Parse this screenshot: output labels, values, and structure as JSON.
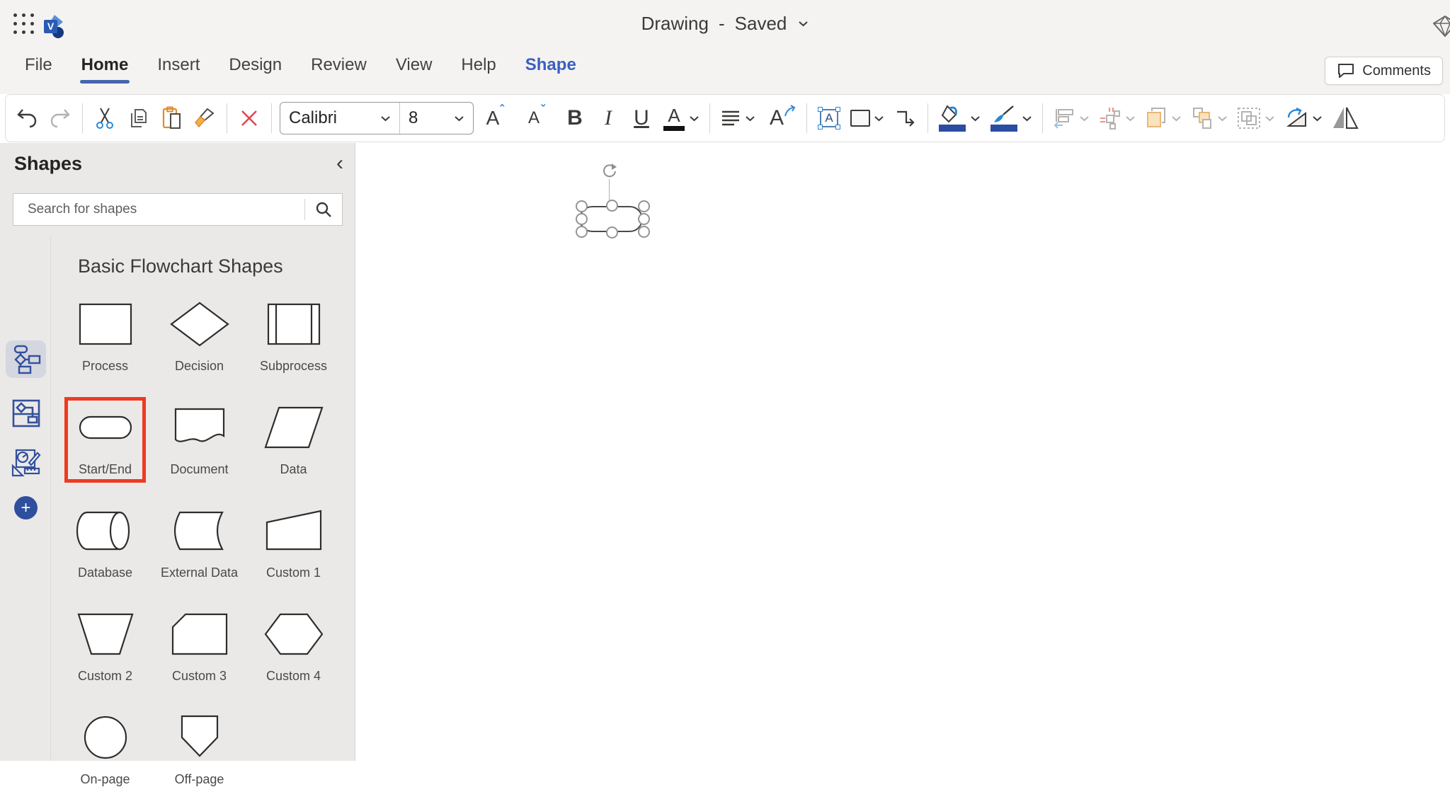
{
  "app": {
    "doc_name": "Drawing",
    "save_status": "Saved"
  },
  "menu": {
    "items": [
      {
        "label": "File",
        "state": "normal"
      },
      {
        "label": "Home",
        "state": "active"
      },
      {
        "label": "Insert",
        "state": "normal"
      },
      {
        "label": "Design",
        "state": "normal"
      },
      {
        "label": "Review",
        "state": "normal"
      },
      {
        "label": "View",
        "state": "normal"
      },
      {
        "label": "Help",
        "state": "normal"
      },
      {
        "label": "Shape",
        "state": "accent"
      }
    ],
    "comments_label": "Comments"
  },
  "toolbar": {
    "font_name": "Calibri",
    "font_size": "8",
    "bold_label": "B",
    "italic_label": "I",
    "underline_label": "U",
    "grow_font_label": "A",
    "shrink_font_label": "A",
    "font_color_label": "A",
    "text_rotate_label": "A",
    "textbox_label": "A"
  },
  "shapes_panel": {
    "title": "Shapes",
    "search_placeholder": "Search for shapes",
    "section_title": "Basic Flowchart Shapes",
    "items": [
      {
        "label": "Process",
        "icon": "process"
      },
      {
        "label": "Decision",
        "icon": "decision"
      },
      {
        "label": "Subprocess",
        "icon": "subprocess"
      },
      {
        "label": "Start/End",
        "icon": "startend",
        "highlighted": true
      },
      {
        "label": "Document",
        "icon": "document"
      },
      {
        "label": "Data",
        "icon": "data"
      },
      {
        "label": "Database",
        "icon": "database"
      },
      {
        "label": "External Data",
        "icon": "external"
      },
      {
        "label": "Custom 1",
        "icon": "custom1"
      },
      {
        "label": "Custom 2",
        "icon": "custom2"
      },
      {
        "label": "Custom 3",
        "icon": "custom3"
      },
      {
        "label": "Custom 4",
        "icon": "custom4"
      },
      {
        "label": "On-page",
        "icon": "onpage"
      },
      {
        "label": "Off-page",
        "icon": "offpage"
      }
    ]
  },
  "canvas": {
    "selected_shape": "Start/End"
  },
  "colors": {
    "accent_blue": "#4565ad",
    "shape_tab_blue": "#3b5fc0",
    "highlight_red": "#ee3a21",
    "stencil_blue": "#33509e",
    "fill_bar_blue": "#2a4da1"
  }
}
